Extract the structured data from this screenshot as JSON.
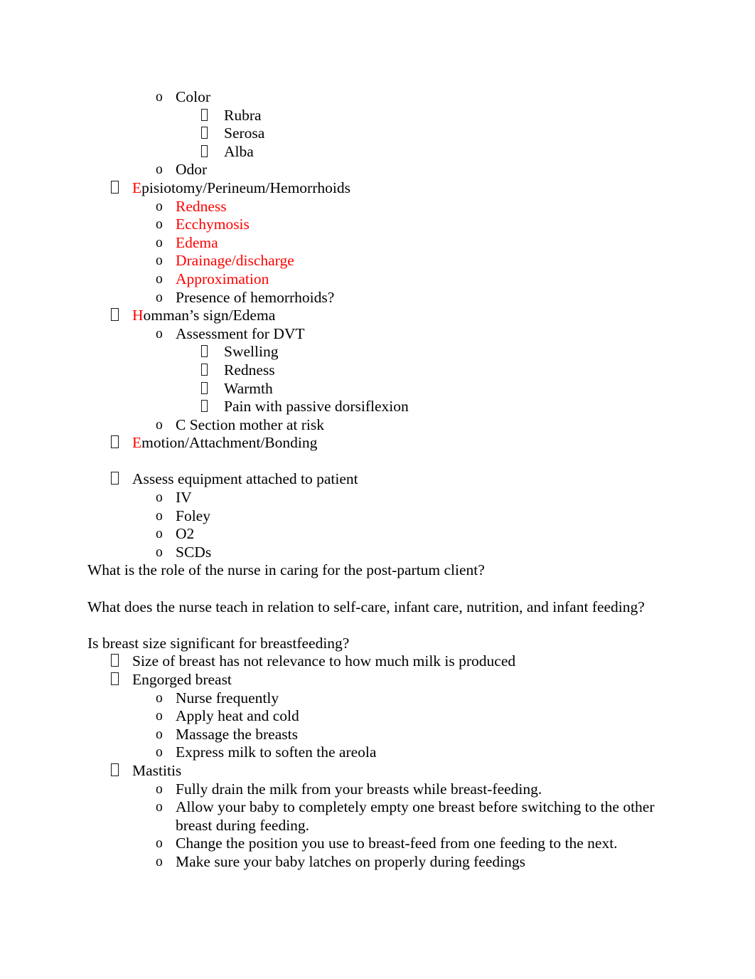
{
  "document": {
    "bullet_glyphs": {
      "level1": "wingdings-box-bullet",
      "level2": "o",
      "level3": "wingdings-box-bullet-small"
    },
    "accent_color": "#ff0000",
    "text_color": "#000000",
    "background_color": "#ffffff"
  },
  "blocks": [
    {
      "level": 2,
      "text": "Color"
    },
    {
      "level": 3,
      "text": "Rubra"
    },
    {
      "level": 3,
      "text": "Serosa"
    },
    {
      "level": 3,
      "text": "Alba"
    },
    {
      "level": 2,
      "text": "Odor"
    },
    {
      "level": 1,
      "lead_red": "E",
      "rest": "pisiotomy/Perineum/Hemorrhoids"
    },
    {
      "level": 2,
      "text": "Redness",
      "color": "red"
    },
    {
      "level": 2,
      "text": "Ecchymosis",
      "color": "red"
    },
    {
      "level": 2,
      "text": "Edema",
      "color": "red"
    },
    {
      "level": 2,
      "text": "Drainage/discharge",
      "color": "red"
    },
    {
      "level": 2,
      "text": "Approximation",
      "color": "red"
    },
    {
      "level": 2,
      "text": "Presence of hemorrhoids?"
    },
    {
      "level": 1,
      "lead_red": "H",
      "rest": "omman’s sign/Edema"
    },
    {
      "level": 2,
      "text": "Assessment for DVT"
    },
    {
      "level": 3,
      "text": "Swelling"
    },
    {
      "level": 3,
      "text": "Redness"
    },
    {
      "level": 3,
      "text": "Warmth"
    },
    {
      "level": 3,
      "text": "Pain with passive dorsiflexion"
    },
    {
      "level": 2,
      "text": "C Section mother at risk"
    },
    {
      "level": 1,
      "lead_red": "E",
      "rest": "motion/Attachment/Bonding"
    },
    {
      "level": 0,
      "text": ""
    },
    {
      "level": 1,
      "text": "Assess equipment attached to patient"
    },
    {
      "level": 2,
      "text": "IV"
    },
    {
      "level": 2,
      "text": "Foley"
    },
    {
      "level": 2,
      "text": "O2"
    },
    {
      "level": 2,
      "text": "SCDs"
    },
    {
      "level": 0,
      "text": "What is the role of the nurse in caring for the post-partum client?"
    },
    {
      "level": 0,
      "text": ""
    },
    {
      "level": 0,
      "text": "What does the nurse teach in relation to self-care, infant care, nutrition, and infant feeding?"
    },
    {
      "level": 0,
      "text": ""
    },
    {
      "level": 0,
      "text": "Is breast size significant for breastfeeding?"
    },
    {
      "level": 1,
      "text": "Size of breast has not relevance to how much milk is produced"
    },
    {
      "level": 1,
      "text": "Engorged breast"
    },
    {
      "level": 2,
      "text": "Nurse frequently"
    },
    {
      "level": 2,
      "text": "Apply heat and cold"
    },
    {
      "level": 2,
      "text": "Massage the breasts"
    },
    {
      "level": 2,
      "text": "Express milk to soften the areola"
    },
    {
      "level": 1,
      "text": "Mastitis"
    },
    {
      "level": 2,
      "text": "Fully drain the milk from your breasts while breast-feeding."
    },
    {
      "level": 2,
      "text": "Allow your baby to completely empty one breast before switching to the other breast during feeding."
    },
    {
      "level": 2,
      "text": "Change the position you use to breast-feed from one feeding to the next."
    },
    {
      "level": 2,
      "text": "Make sure your baby latches on properly during feedings"
    }
  ]
}
